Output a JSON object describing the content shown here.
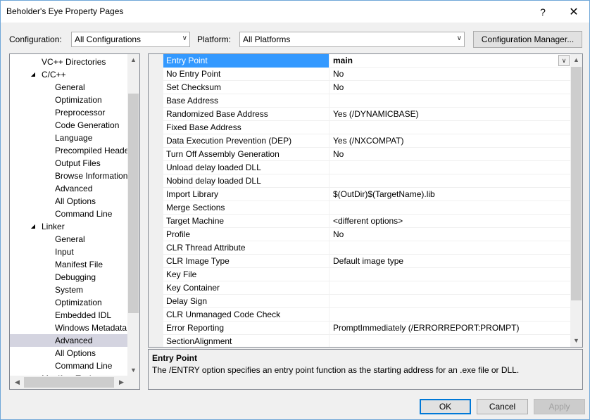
{
  "window": {
    "title": "Beholder's Eye Property Pages",
    "help_glyph": "?",
    "close_glyph": "✕"
  },
  "toolbar": {
    "configuration_label": "Configuration:",
    "configuration_value": "All Configurations",
    "platform_label": "Platform:",
    "platform_value": "All Platforms",
    "config_manager_label": "Configuration Manager..."
  },
  "tree": {
    "items": [
      {
        "label": "VC++ Directories",
        "level": 1,
        "expander": ""
      },
      {
        "label": "C/C++",
        "level": 1,
        "expander": "◢"
      },
      {
        "label": "General",
        "level": 2,
        "expander": ""
      },
      {
        "label": "Optimization",
        "level": 2,
        "expander": ""
      },
      {
        "label": "Preprocessor",
        "level": 2,
        "expander": ""
      },
      {
        "label": "Code Generation",
        "level": 2,
        "expander": ""
      },
      {
        "label": "Language",
        "level": 2,
        "expander": ""
      },
      {
        "label": "Precompiled Heade",
        "level": 2,
        "expander": ""
      },
      {
        "label": "Output Files",
        "level": 2,
        "expander": ""
      },
      {
        "label": "Browse Information",
        "level": 2,
        "expander": ""
      },
      {
        "label": "Advanced",
        "level": 2,
        "expander": ""
      },
      {
        "label": "All Options",
        "level": 2,
        "expander": ""
      },
      {
        "label": "Command Line",
        "level": 2,
        "expander": ""
      },
      {
        "label": "Linker",
        "level": 1,
        "expander": "◢"
      },
      {
        "label": "General",
        "level": 2,
        "expander": ""
      },
      {
        "label": "Input",
        "level": 2,
        "expander": ""
      },
      {
        "label": "Manifest File",
        "level": 2,
        "expander": ""
      },
      {
        "label": "Debugging",
        "level": 2,
        "expander": ""
      },
      {
        "label": "System",
        "level": 2,
        "expander": ""
      },
      {
        "label": "Optimization",
        "level": 2,
        "expander": ""
      },
      {
        "label": "Embedded IDL",
        "level": 2,
        "expander": ""
      },
      {
        "label": "Windows Metadata",
        "level": 2,
        "expander": ""
      },
      {
        "label": "Advanced",
        "level": 2,
        "expander": "",
        "selected": true
      },
      {
        "label": "All Options",
        "level": 2,
        "expander": ""
      },
      {
        "label": "Command Line",
        "level": 2,
        "expander": ""
      },
      {
        "label": "Manifest Tool",
        "level": 1,
        "expander": "▷"
      }
    ]
  },
  "properties": [
    {
      "name": "Entry Point",
      "value": "main",
      "selected": true
    },
    {
      "name": "No Entry Point",
      "value": "No"
    },
    {
      "name": "Set Checksum",
      "value": "No"
    },
    {
      "name": "Base Address",
      "value": ""
    },
    {
      "name": "Randomized Base Address",
      "value": "Yes (/DYNAMICBASE)"
    },
    {
      "name": "Fixed Base Address",
      "value": ""
    },
    {
      "name": "Data Execution Prevention (DEP)",
      "value": "Yes (/NXCOMPAT)"
    },
    {
      "name": "Turn Off Assembly Generation",
      "value": "No"
    },
    {
      "name": "Unload delay loaded DLL",
      "value": ""
    },
    {
      "name": "Nobind delay loaded DLL",
      "value": ""
    },
    {
      "name": "Import Library",
      "value": "$(OutDir)$(TargetName).lib"
    },
    {
      "name": "Merge Sections",
      "value": ""
    },
    {
      "name": "Target Machine",
      "value": "<different options>"
    },
    {
      "name": "Profile",
      "value": "No"
    },
    {
      "name": "CLR Thread Attribute",
      "value": ""
    },
    {
      "name": "CLR Image Type",
      "value": "Default image type"
    },
    {
      "name": "Key File",
      "value": ""
    },
    {
      "name": "Key Container",
      "value": ""
    },
    {
      "name": "Delay Sign",
      "value": ""
    },
    {
      "name": "CLR Unmanaged Code Check",
      "value": ""
    },
    {
      "name": "Error Reporting",
      "value": "PromptImmediately (/ERRORREPORT:PROMPT)"
    },
    {
      "name": "SectionAlignment",
      "value": ""
    }
  ],
  "description": {
    "title": "Entry Point",
    "text": "The /ENTRY option specifies an entry point function as the starting address for an .exe file or DLL."
  },
  "buttons": {
    "ok": "OK",
    "cancel": "Cancel",
    "apply": "Apply"
  },
  "icons": {
    "dropdown": "chevron-down-icon",
    "scroll_up": "scroll-up-arrow-icon",
    "scroll_down": "scroll-down-arrow-icon",
    "scroll_left": "scroll-left-arrow-icon",
    "scroll_right": "scroll-right-arrow-icon"
  },
  "colors": {
    "selection_blue": "#3399ff",
    "tree_selection": "#d4d4e0",
    "default_button_border": "#0078d7"
  }
}
